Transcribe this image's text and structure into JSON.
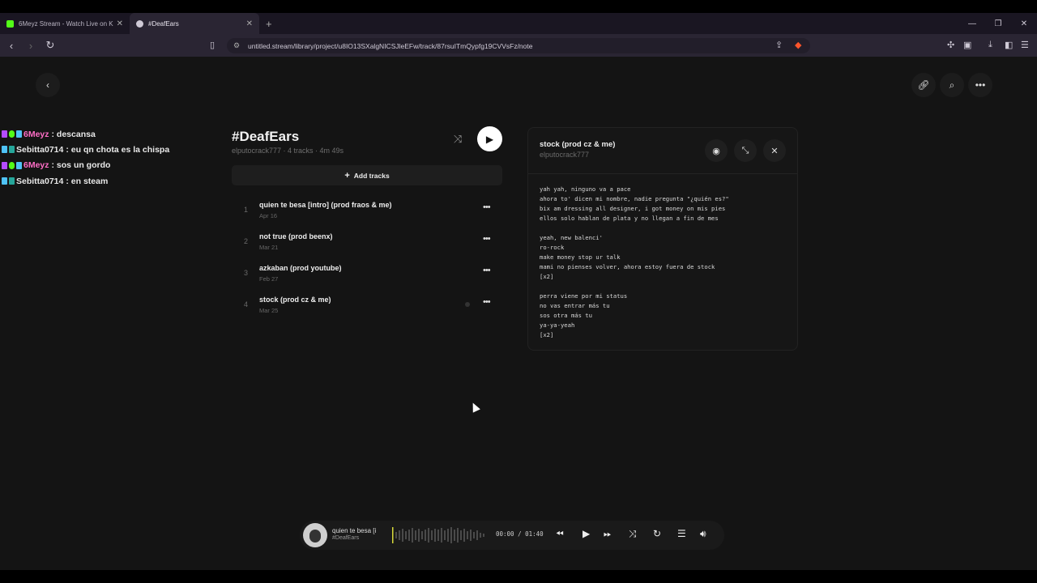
{
  "browser": {
    "tabs": [
      {
        "label": "6Meyz Stream - Watch Live on K",
        "favicon_color": "#53fc18"
      },
      {
        "label": "#DeafEars",
        "favicon_color": "#cfcad6"
      }
    ],
    "url": "untitled.stream/library/project/u8IO13SXalgNICSJleEFw/track/87rsuITmQypfg19CVVsFz/note"
  },
  "chat": {
    "messages": [
      {
        "user": "6Meyz",
        "text": ": descansa",
        "user_color": "#ff6ec7"
      },
      {
        "user": "Sebitta0714",
        "text": ": eu qn chota es la chispa",
        "user_color": "#e8e8e8"
      },
      {
        "user": "6Meyz",
        "text": ": sos un gordo",
        "user_color": "#ff6ec7"
      },
      {
        "user": "Sebitta0714",
        "text": ": en steam",
        "user_color": "#e8e8e8"
      }
    ]
  },
  "project": {
    "title": "#DeafEars",
    "subtitle": "elputocrack777 · 4 tracks · 4m 49s",
    "add_tracks_label": "Add tracks",
    "tracks": [
      {
        "num": "1",
        "name": "quien te besa [intro] (prod fraos & me)",
        "date": "Apr 16"
      },
      {
        "num": "2",
        "name": "not true (prod beenx)",
        "date": "Mar 21"
      },
      {
        "num": "3",
        "name": "azkaban (prod youtube)",
        "date": "Feb 27"
      },
      {
        "num": "4",
        "name": "stock (prod cz & me)",
        "date": "Mar 25"
      }
    ]
  },
  "note": {
    "title": "stock (prod cz & me)",
    "artist": "elputocrack777",
    "lyrics": "yah yah, ninguno va a pace\nahora to' dicen mi nombre, nadie pregunta \"¿quién es?\"\nbix am dressing all designer, i got money on mis pies\nellos solo hablan de plata y no llegan a fin de mes\n\nyeah, new balenci'\nro-rock\nmake money stop ur talk\nmami no pienses volver, ahora estoy fuera de stock\n[x2]\n\nperra viene por mi status\nno vas entrar más tu\nsos otra más tu\nya-ya-yeah\n[x2]"
  },
  "player": {
    "title": "quien te besa [i",
    "subtitle": "#DeafEars",
    "time": "00:00 / 01:40"
  }
}
